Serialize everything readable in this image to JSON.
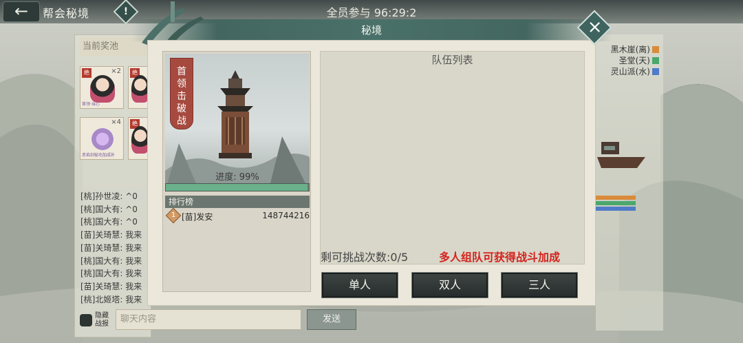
{
  "header": {
    "title": "帮会秘境",
    "countdown": "全员参与 96:29:2",
    "back_icon": "arrow-left-icon",
    "info_icon": "exclamation-icon"
  },
  "left_panel": {
    "pool_label": "当前奖池",
    "cards": [
      {
        "badge": "绝",
        "count": "×2",
        "caption": "首领·当心"
      },
      {
        "badge": "绝",
        "count": "",
        "caption": ""
      },
      {
        "badge": "",
        "count": "×4",
        "caption": "赤焰剑秘功加成补"
      },
      {
        "badge": "绝",
        "count": "",
        "caption": ""
      }
    ],
    "chat_lines": [
      "[桃]孙世凌: ^0",
      "[桃]国大有: ^0",
      "[桃]国大有: ^0",
      "[苗]关琦慧: 我来",
      "[苗]关琦慧: 我来",
      "[桃]国大有: 我来",
      "[桃]国大有: 我来",
      "[苗]关琦慧: 我来",
      "[桃]北姬塔: 我来"
    ],
    "hide_report_label": "隐藏战报",
    "chat_placeholder": "聊天内容",
    "send_label": "发送"
  },
  "right_panel": {
    "sects": [
      {
        "name": "黑木崖(离)",
        "color": "#d98b3a"
      },
      {
        "name": "圣堂(天)",
        "color": "#4aa86c"
      },
      {
        "name": "灵山派(水)",
        "color": "#4f7bc9"
      }
    ],
    "bars": [
      "#d98b3a",
      "#4aa86c",
      "#4f7bc9"
    ]
  },
  "modal": {
    "title": "秘境",
    "close_icon": "close-icon",
    "boss": {
      "label_chars": [
        "首",
        "领",
        "击",
        "破",
        "战"
      ],
      "progress_text": "进度: 99%",
      "progress": 0.99
    },
    "ranking": {
      "header": "排行榜",
      "rows": [
        {
          "rank": "1",
          "name": "[苗]发安",
          "score": "148744216"
        }
      ]
    },
    "team": {
      "title": "队伍列表",
      "remaining": "剩可挑战次数:0/5",
      "bonus_tip": "多人组队可获得战斗加成"
    },
    "buttons": {
      "single": "单人",
      "double": "双人",
      "triple": "三人"
    }
  }
}
